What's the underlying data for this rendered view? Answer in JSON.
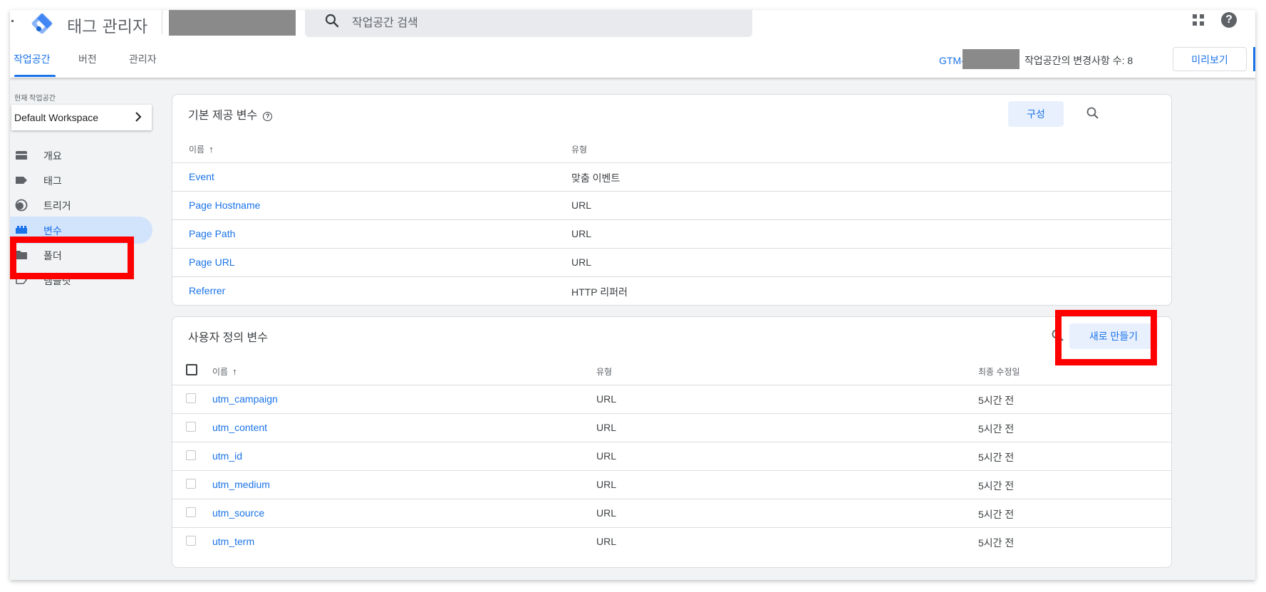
{
  "header": {
    "app_title": "태그 관리자",
    "search_placeholder": "작업공간 검색"
  },
  "nav": {
    "tabs": [
      "작업공간",
      "버전",
      "관리자"
    ],
    "container_id_prefix": "GTM-",
    "changes_text": "작업공간의 변경사항 수: 8",
    "preview_label": "미리보기"
  },
  "sidebar": {
    "workspace_label": "현재 작업공간",
    "workspace_name": "Default Workspace",
    "items": [
      {
        "label": "개요",
        "icon": "overview-icon"
      },
      {
        "label": "태그",
        "icon": "tag-icon"
      },
      {
        "label": "트리거",
        "icon": "trigger-icon"
      },
      {
        "label": "변수",
        "icon": "variables-icon",
        "active": true
      },
      {
        "label": "폴더",
        "icon": "folder-icon"
      },
      {
        "label": "템플릿",
        "icon": "template-icon"
      }
    ]
  },
  "builtin": {
    "title": "기본 제공 변수",
    "configure_label": "구성",
    "col_name": "이름",
    "col_type": "유형",
    "rows": [
      {
        "name": "Event",
        "type": "맞춤 이벤트"
      },
      {
        "name": "Page Hostname",
        "type": "URL"
      },
      {
        "name": "Page Path",
        "type": "URL"
      },
      {
        "name": "Page URL",
        "type": "URL"
      },
      {
        "name": "Referrer",
        "type": "HTTP 리퍼러"
      }
    ]
  },
  "custom": {
    "title": "사용자 정의 변수",
    "new_label": "새로 만들기",
    "col_name": "이름",
    "col_type": "유형",
    "col_modified": "최종 수정일",
    "rows": [
      {
        "name": "utm_campaign",
        "type": "URL",
        "modified": "5시간 전"
      },
      {
        "name": "utm_content",
        "type": "URL",
        "modified": "5시간 전"
      },
      {
        "name": "utm_id",
        "type": "URL",
        "modified": "5시간 전"
      },
      {
        "name": "utm_medium",
        "type": "URL",
        "modified": "5시간 전"
      },
      {
        "name": "utm_source",
        "type": "URL",
        "modified": "5시간 전"
      },
      {
        "name": "utm_term",
        "type": "URL",
        "modified": "5시간 전"
      }
    ]
  },
  "colors": {
    "accent": "#1a73e8",
    "highlight": "#ff0000",
    "active_bg": "#d2e3fc"
  }
}
